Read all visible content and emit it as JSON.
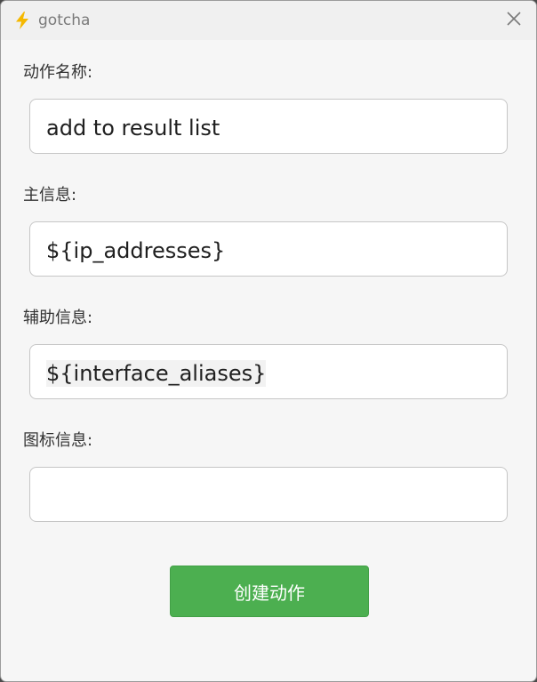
{
  "window": {
    "title": "gotcha",
    "icon": "lightning-icon",
    "close_icon": "close-icon"
  },
  "form": {
    "action_name": {
      "label": "动作名称:",
      "value": "add to result list"
    },
    "main_info": {
      "label": "主信息:",
      "value": "${ip_addresses}"
    },
    "aux_info": {
      "label": "辅助信息:",
      "value": "${interface_aliases}"
    },
    "icon_info": {
      "label": "图标信息:",
      "value": ""
    }
  },
  "create_button": {
    "label": "创建动作"
  },
  "colors": {
    "accent": "#4caf50",
    "window_bg": "#f6f6f6",
    "titlebar_bg": "#f0f0f0",
    "icon_yellow": "#f5b800"
  }
}
